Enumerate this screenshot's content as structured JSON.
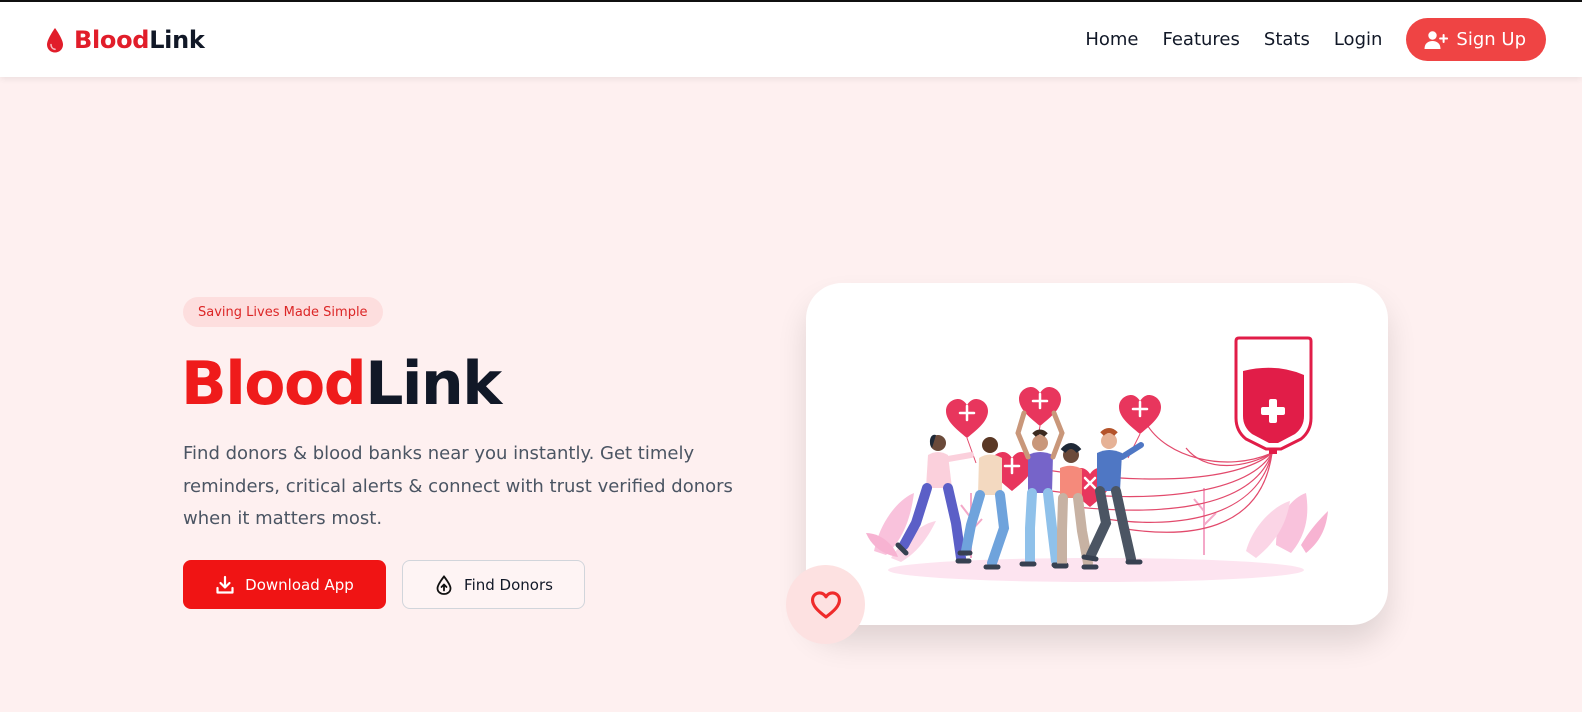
{
  "brand": {
    "name_part1": "Blood",
    "name_part2": "Link",
    "logo_icon": "blood-drop-icon"
  },
  "nav": {
    "items": [
      {
        "label": "Home"
      },
      {
        "label": "Features"
      },
      {
        "label": "Stats"
      },
      {
        "label": "Login"
      }
    ],
    "signup_label": "Sign Up",
    "signup_icon": "user-plus-icon"
  },
  "hero": {
    "badge": "Saving Lives Made Simple",
    "title_part1": "Blood",
    "title_part2": "Link",
    "description": "Find donors & blood banks near you instantly. Get timely reminders, critical alerts & connect with trust verified donors when it matters most.",
    "primary_button": {
      "label": "Download App",
      "icon": "download-icon"
    },
    "secondary_button": {
      "label": "Find Donors",
      "icon": "donor-drop-icon"
    }
  },
  "illustration": {
    "subject": "donors-with-heart-balloons-blood-bag",
    "floating_icon": "heart-icon"
  },
  "colors": {
    "accent": "#ef4444",
    "brand_red": "#e11d2a",
    "primary_button": "#f01414",
    "page_background": "#fef0f0",
    "badge_background": "#fddede"
  }
}
